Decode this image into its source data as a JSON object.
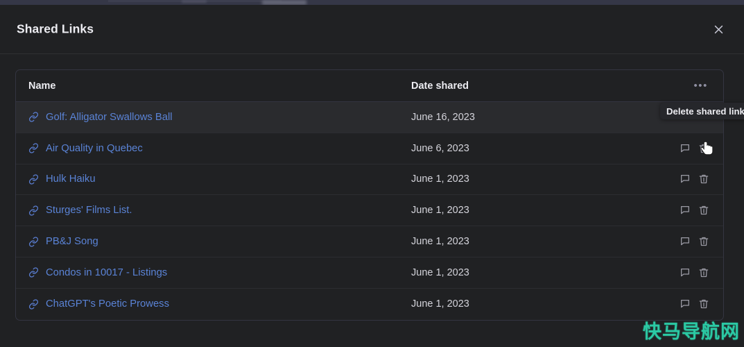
{
  "modal": {
    "title": "Shared Links",
    "close_icon": "close-icon"
  },
  "table": {
    "columns": {
      "name": "Name",
      "date": "Date shared",
      "menu": "•••"
    },
    "rows": [
      {
        "name": "Golf: Alligator Swallows Ball",
        "date": "June 16, 2023"
      },
      {
        "name": "Air Quality in Quebec",
        "date": "June 6, 2023"
      },
      {
        "name": "Hulk Haiku",
        "date": "June 1, 2023"
      },
      {
        "name": "Sturges' Films List.",
        "date": "June 1, 2023"
      },
      {
        "name": "PB&J Song",
        "date": "June 1, 2023"
      },
      {
        "name": "Condos in 10017 - Listings",
        "date": "June 1, 2023"
      },
      {
        "name": "ChatGPT's Poetic Prowess",
        "date": "June 1, 2023"
      }
    ],
    "row_icons": {
      "link": "link-icon",
      "comment": "comment-icon",
      "delete": "trash-icon"
    }
  },
  "tooltip": {
    "text": "Delete shared link"
  },
  "watermark": {
    "text": "快马导航网"
  },
  "colors": {
    "background": "#202123",
    "row_hover": "#2a2b2e",
    "link_blue": "#5a83d6",
    "text_primary": "#ececf1",
    "text_secondary": "#d3d3da",
    "icon_muted": "#9b9ba5",
    "border": "#343541",
    "watermark_green": "#2bc9a4"
  }
}
